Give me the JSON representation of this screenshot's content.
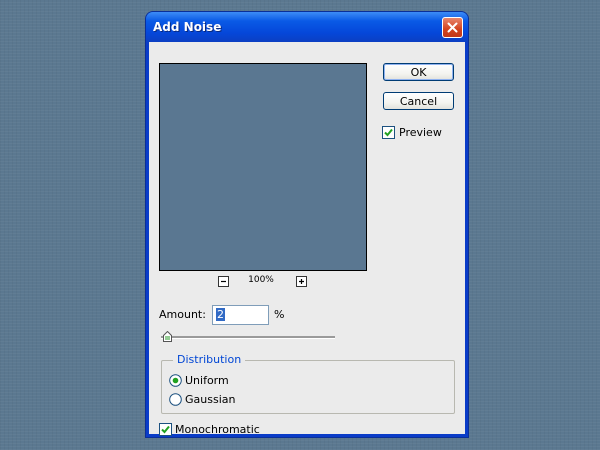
{
  "dialog": {
    "title": "Add Noise",
    "ok_label": "OK",
    "cancel_label": "Cancel",
    "preview_label": "Preview",
    "preview_checked": true
  },
  "zoom": {
    "level": "100%",
    "zoom_out_symbol": "−",
    "zoom_in_symbol": "+"
  },
  "amount": {
    "label": "Amount:",
    "value": "2",
    "unit": "%"
  },
  "distribution": {
    "legend": "Distribution",
    "options": [
      "Uniform",
      "Gaussian"
    ],
    "selected": "Uniform"
  },
  "monochromatic": {
    "label": "Monochromatic",
    "checked": true
  },
  "colors": {
    "title_bar": "#0a5ae6",
    "dialog_face": "#ebebeb",
    "preview_fill": "#5a7791",
    "check_mark": "#21a121"
  },
  "icons": {
    "close": "close-icon",
    "check": "checkmark-icon"
  }
}
